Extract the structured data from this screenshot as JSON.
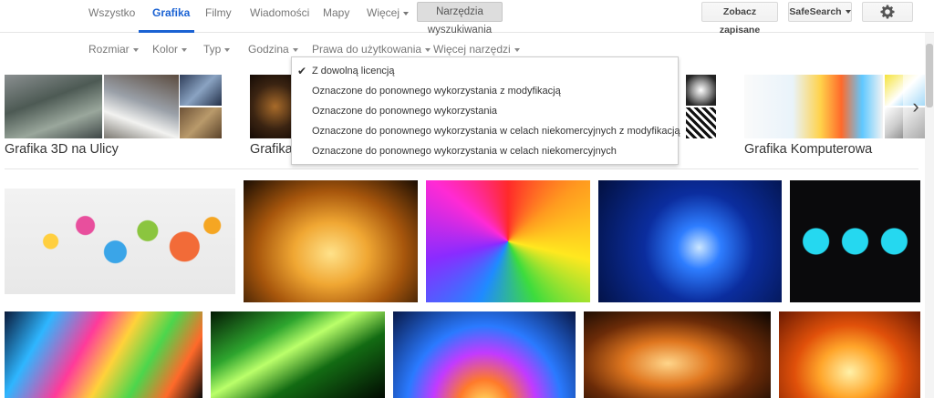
{
  "nav": {
    "tabs": [
      {
        "label": "Wszystko"
      },
      {
        "label": "Grafika"
      },
      {
        "label": "Filmy"
      },
      {
        "label": "Wiadomości"
      },
      {
        "label": "Mapy"
      },
      {
        "label": "Więcej"
      }
    ],
    "active_tab": "Grafika",
    "tools_label": "Narzędzia wyszukiwania",
    "saved_label": "Zobacz zapisane",
    "safesearch_label": "SafeSearch",
    "settings_icon": "gear-icon"
  },
  "filters": [
    {
      "label": "Rozmiar"
    },
    {
      "label": "Kolor"
    },
    {
      "label": "Typ"
    },
    {
      "label": "Godzina"
    },
    {
      "label": "Prawa do użytkowania"
    },
    {
      "label": "Więcej narzędzi"
    }
  ],
  "usage_rights_menu": {
    "items": [
      {
        "label": "Z dowolną licencją",
        "checked": true
      },
      {
        "label": "Oznaczone do ponownego wykorzystania z modyfikacją",
        "checked": false
      },
      {
        "label": "Oznaczone do ponownego wykorzystania",
        "checked": false
      },
      {
        "label": "Oznaczone do ponownego wykorzystania w celach niekomercyjnych z modyfikacją",
        "checked": false
      },
      {
        "label": "Oznaczone do ponownego wykorzystania w celach niekomercyjnych",
        "checked": false
      }
    ]
  },
  "related": [
    {
      "label": "Grafika 3D na Ulicy"
    },
    {
      "label": "Grafika"
    },
    {
      "label": "Grafika Komputerowa"
    }
  ],
  "colors": {
    "accent": "#1a62d3",
    "muted_text": "#777777"
  }
}
